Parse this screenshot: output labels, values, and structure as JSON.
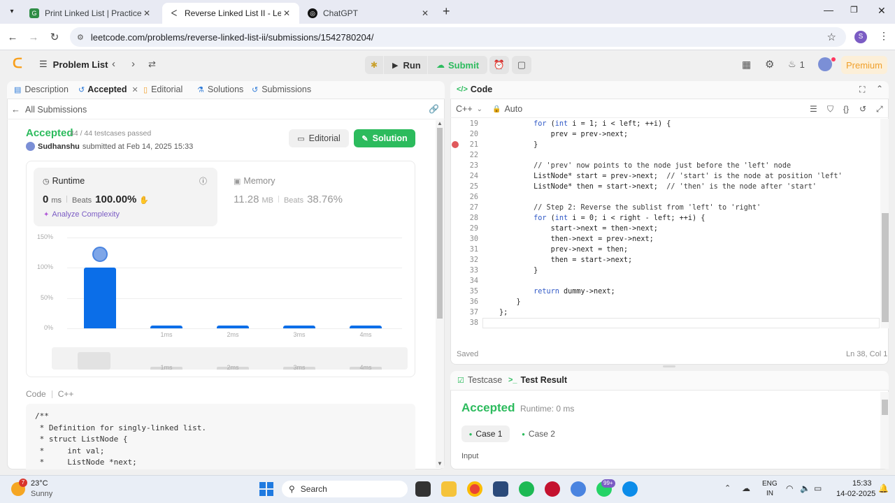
{
  "browser": {
    "tabs": [
      {
        "title": "Print Linked List | Practice | Gee",
        "active": false
      },
      {
        "title": "Reverse Linked List II - LeetCod",
        "active": true
      },
      {
        "title": "ChatGPT",
        "active": false
      }
    ],
    "url": "leetcode.com/problems/reverse-linked-list-ii/submissions/1542780204/",
    "profile_initial": "S"
  },
  "header": {
    "problem_list": "Problem List",
    "run": "Run",
    "submit": "Submit",
    "streak": "1",
    "premium": "Premium"
  },
  "left_tabs": {
    "description": "Description",
    "accepted": "Accepted",
    "editorial": "Editorial",
    "solutions": "Solutions",
    "submissions": "Submissions"
  },
  "submission": {
    "back": "All Submissions",
    "status": "Accepted",
    "testcases": "44 / 44 testcases passed",
    "user": "Sudhanshu",
    "submitted": "submitted at Feb 14, 2025 15:33",
    "editorial_btn": "Editorial",
    "solution_btn": "Solution",
    "runtime_label": "Runtime",
    "runtime_value": "0",
    "runtime_unit": "ms",
    "beats_label": "Beats",
    "runtime_beats": "100.00%",
    "analyze": "Analyze Complexity",
    "memory_label": "Memory",
    "memory_value": "11.28",
    "memory_unit": "MB",
    "memory_beats": "38.76%"
  },
  "chart_data": {
    "type": "bar",
    "categories": [
      "0ms",
      "1ms",
      "2ms",
      "3ms",
      "4ms"
    ],
    "tick_labels": [
      "",
      "1ms",
      "2ms",
      "3ms",
      "4ms"
    ],
    "values": [
      100,
      2,
      2,
      2,
      2
    ],
    "ylabel_ticks": [
      "150%",
      "100%",
      "50%",
      "0%"
    ],
    "ylim": [
      0,
      150
    ],
    "grid": true,
    "colors": {
      "bar": "#0b6ee8"
    }
  },
  "left_code": {
    "label": "Code",
    "lang": "C++",
    "lines": [
      "/**",
      " * Definition for singly-linked list.",
      " * struct ListNode {",
      " *     int val;",
      " *     ListNode *next;"
    ]
  },
  "editor": {
    "title": "Code",
    "lang": "C++",
    "mode": "Auto",
    "start_line": 19,
    "lines": [
      "        for (int i = 1; i < left; ++i) {",
      "            prev = prev->next;",
      "        }",
      "",
      "        // 'prev' now points to the node just before the 'left' node",
      "        ListNode* start = prev->next;  // 'start' is the node at position 'left'",
      "        ListNode* then = start->next;  // 'then' is the node after 'start'",
      "",
      "        // Step 2: Reverse the sublist from 'left' to 'right'",
      "        for (int i = 0; i < right - left; ++i) {",
      "            start->next = then->next;",
      "            then->next = prev->next;",
      "            prev->next = then;",
      "            then = start->next;",
      "        }",
      "",
      "        return dummy->next;",
      "    }",
      "};",
      ""
    ],
    "saved": "Saved",
    "cursor": "Ln 38, Col 1"
  },
  "results": {
    "testcase_tab": "Testcase",
    "result_tab": "Test Result",
    "status": "Accepted",
    "runtime": "Runtime: 0 ms",
    "cases": [
      "Case 1",
      "Case 2"
    ],
    "input_label": "Input"
  },
  "taskbar": {
    "weather_temp": "23°C",
    "weather_desc": "Sunny",
    "weather_badge": "7",
    "search": "Search",
    "lang1": "ENG",
    "lang2": "IN",
    "time": "15:33",
    "date": "14-02-2025",
    "whatsapp_badge": "99+"
  }
}
